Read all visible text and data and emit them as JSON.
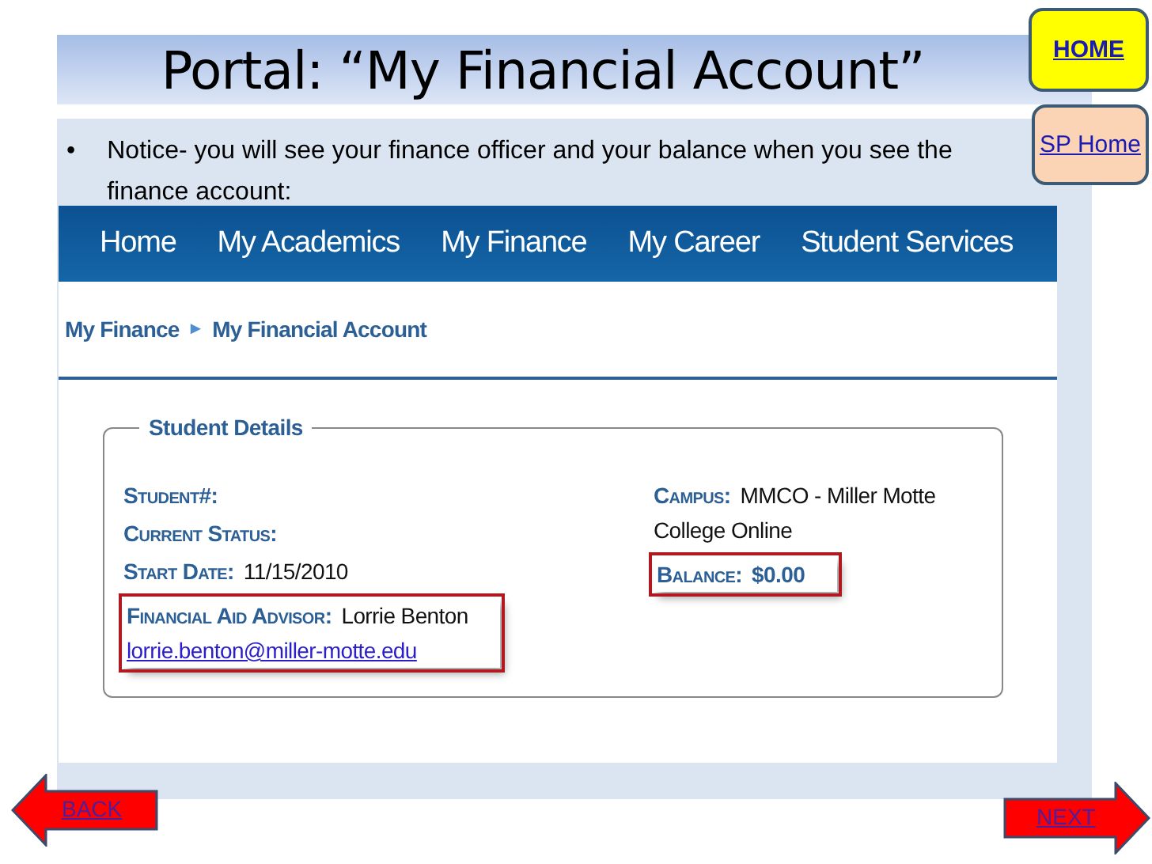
{
  "title": "Portal: “My Financial Account”",
  "corner_links": [
    {
      "label": "HOME",
      "kind": "home"
    },
    {
      "label": "SP Home",
      "kind": "sp"
    }
  ],
  "bullet": {
    "marker": "•",
    "text": "Notice- you will see your finance officer and your balance when you see the finance account:"
  },
  "portal": {
    "nav": [
      "Home",
      "My Academics",
      "My Finance",
      "My Career",
      "Student Services"
    ],
    "breadcrumb": {
      "items": [
        "My Finance",
        "My Financial Account"
      ],
      "separator": "►"
    },
    "details": {
      "legend": "Student Details",
      "left": [
        {
          "label": "Student#:",
          "highlighted": false
        },
        {
          "label": "Current Status:",
          "highlighted": false
        },
        {
          "label": "Start Date:",
          "value": "11/15/2010",
          "highlighted": false
        },
        {
          "label": "Financial Aid Advisor:",
          "value": "Lorrie Benton",
          "email": "lorrie.benton@miller-motte.edu",
          "highlighted": true
        }
      ],
      "right": [
        {
          "label": "Campus:",
          "value": "MMCO - Miller Motte College Online",
          "highlighted": false
        },
        {
          "label": "Balance:",
          "value": "$0.00",
          "highlighted": true
        }
      ]
    }
  },
  "nav_buttons": [
    {
      "label": "BACK",
      "kind": "back"
    },
    {
      "label": "NEXT",
      "kind": "next"
    }
  ]
}
